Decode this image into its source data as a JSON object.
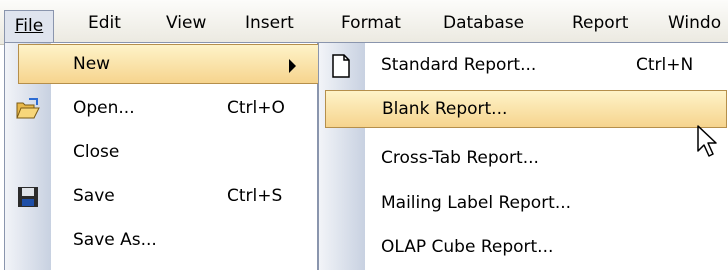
{
  "menubar": {
    "items": [
      "File",
      "Edit",
      "View",
      "Insert",
      "Format",
      "Database",
      "Report",
      "Windo"
    ]
  },
  "file_menu": {
    "items": [
      {
        "label": "New",
        "shortcut": "",
        "icon": "none",
        "submenu": true
      },
      {
        "label": "Open...",
        "shortcut": "Ctrl+O",
        "icon": "open-folder-icon"
      },
      {
        "label": "Close",
        "shortcut": "",
        "icon": "none"
      },
      {
        "label": "Save",
        "shortcut": "Ctrl+S",
        "icon": "save-disk-icon"
      },
      {
        "label": "Save As...",
        "shortcut": "",
        "icon": "none"
      }
    ]
  },
  "new_submenu": {
    "items": [
      {
        "label": "Standard Report...",
        "shortcut": "Ctrl+N",
        "icon": "blank-page-icon"
      },
      {
        "label": "Blank Report...",
        "shortcut": "",
        "icon": "none"
      },
      {
        "label": "Cross-Tab Report...",
        "shortcut": "",
        "icon": "none"
      },
      {
        "label": "Mailing Label Report...",
        "shortcut": "",
        "icon": "none"
      },
      {
        "label": "OLAP Cube Report...",
        "shortcut": "",
        "icon": "none"
      }
    ]
  },
  "colors": {
    "highlight_top": "#fef3c8",
    "highlight_bottom": "#f6d48e",
    "highlight_border": "#b58f4b",
    "menu_border": "#8a95ad",
    "icon_strip": "#c8d1e1"
  }
}
